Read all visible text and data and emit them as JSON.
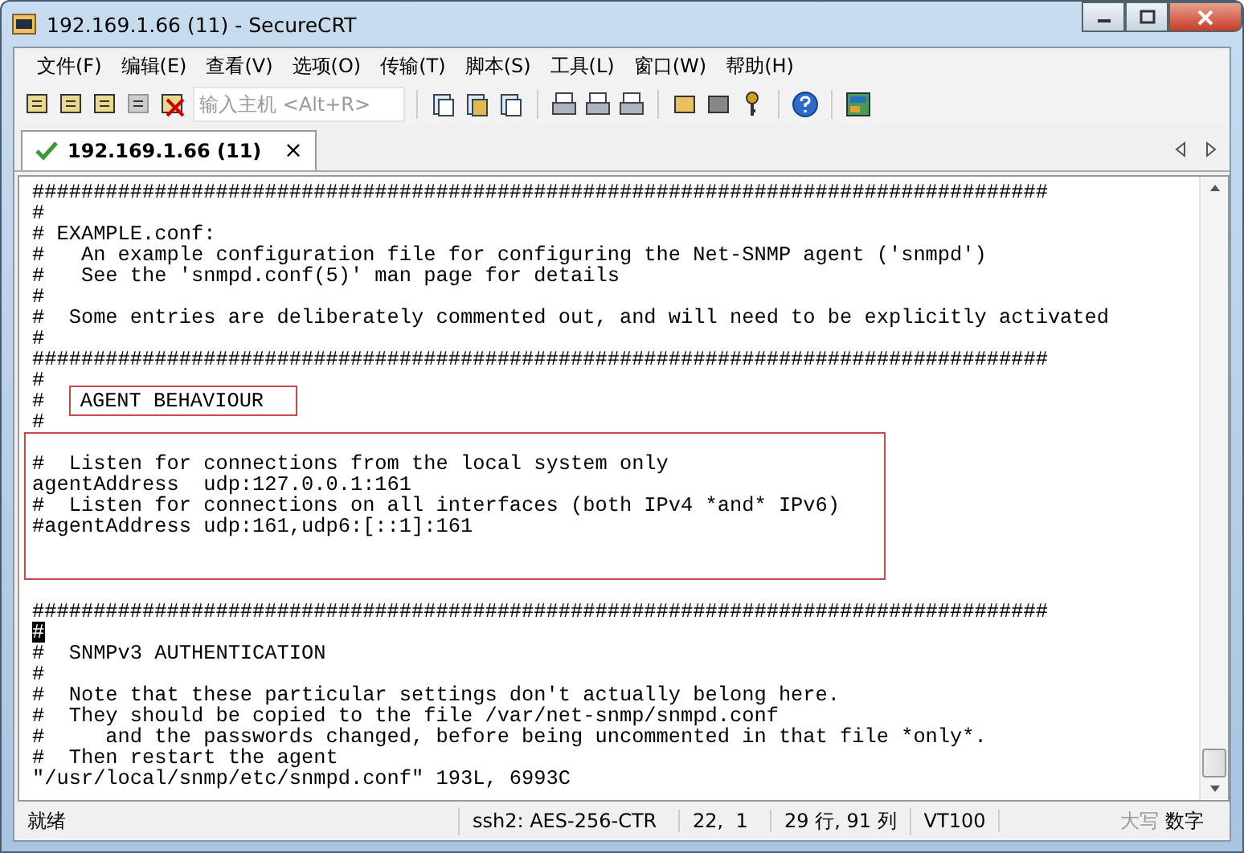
{
  "window": {
    "title": "192.169.1.66 (11) - SecureCRT"
  },
  "menu": [
    "文件(F)",
    "编辑(E)",
    "查看(V)",
    "选项(O)",
    "传输(T)",
    "脚本(S)",
    "工具(L)",
    "窗口(W)",
    "帮助(H)"
  ],
  "toolbar": {
    "host_field": {
      "placeholder": "输入主机 <Alt+R>"
    }
  },
  "tabs": [
    {
      "label": "192.169.1.66 (11)",
      "close": "×",
      "selected": true
    }
  ],
  "terminal": {
    "lines": [
      {
        "text": "###################################################################################"
      },
      {
        "text": "#"
      },
      {
        "text": "# EXAMPLE.conf:"
      },
      {
        "text": "#   An example configuration file for configuring the Net-SNMP agent ('snmpd')"
      },
      {
        "text": "#   See the 'snmpd.conf(5)' man page for details"
      },
      {
        "text": "#"
      },
      {
        "text": "#  Some entries are deliberately commented out, and will need to be explicitly activated"
      },
      {
        "text": "#"
      },
      {
        "text": "###################################################################################"
      },
      {
        "text": "#"
      },
      {
        "text": "#  ",
        "boxed_text": "AGENT BEHAVIOUR"
      },
      {
        "text": "#"
      }
    ],
    "highlighted_block": [
      {
        "text": "#  Listen for connections from the local system only"
      },
      {
        "text": "agentAddress  udp:127.0.0.1:161"
      },
      {
        "text": "#  Listen for connections on all interfaces (both IPv4 *and* IPv6)"
      },
      {
        "text": "#agentAddress udp:161,udp6:[::1]:161"
      }
    ],
    "lines_after": [
      {
        "cursor": false
      },
      {
        "text": "###################################################################################",
        "cursor": false
      },
      {
        "text": "#",
        "cursor": true
      },
      {
        "text": "#  SNMPv3 AUTHENTICATION",
        "cursor": false
      },
      {
        "text": "#",
        "cursor": false
      },
      {
        "text": "#  Note that these particular settings don't actually belong here.",
        "cursor": false
      },
      {
        "text": "#  They should be copied to the file /var/net-snmp/snmpd.conf",
        "cursor": false
      },
      {
        "text": "#     and the passwords changed, before being uncommented in that file *only*.",
        "cursor": false
      },
      {
        "text": "#  Then restart the agent",
        "cursor": false
      },
      {
        "text": "\"/usr/local/snmp/etc/snmpd.conf\" 193L, 6993C",
        "cursor": false
      }
    ]
  },
  "status_bar": {
    "status": "就绪",
    "cipher": "ssh2: AES-256-CTR",
    "cursor_position": "22,  1",
    "size": "29 行, 91 列",
    "emulation": "VT100",
    "indicators": [
      {
        "label": "大写",
        "on": false
      },
      {
        "label": "数字",
        "on": true
      }
    ]
  }
}
